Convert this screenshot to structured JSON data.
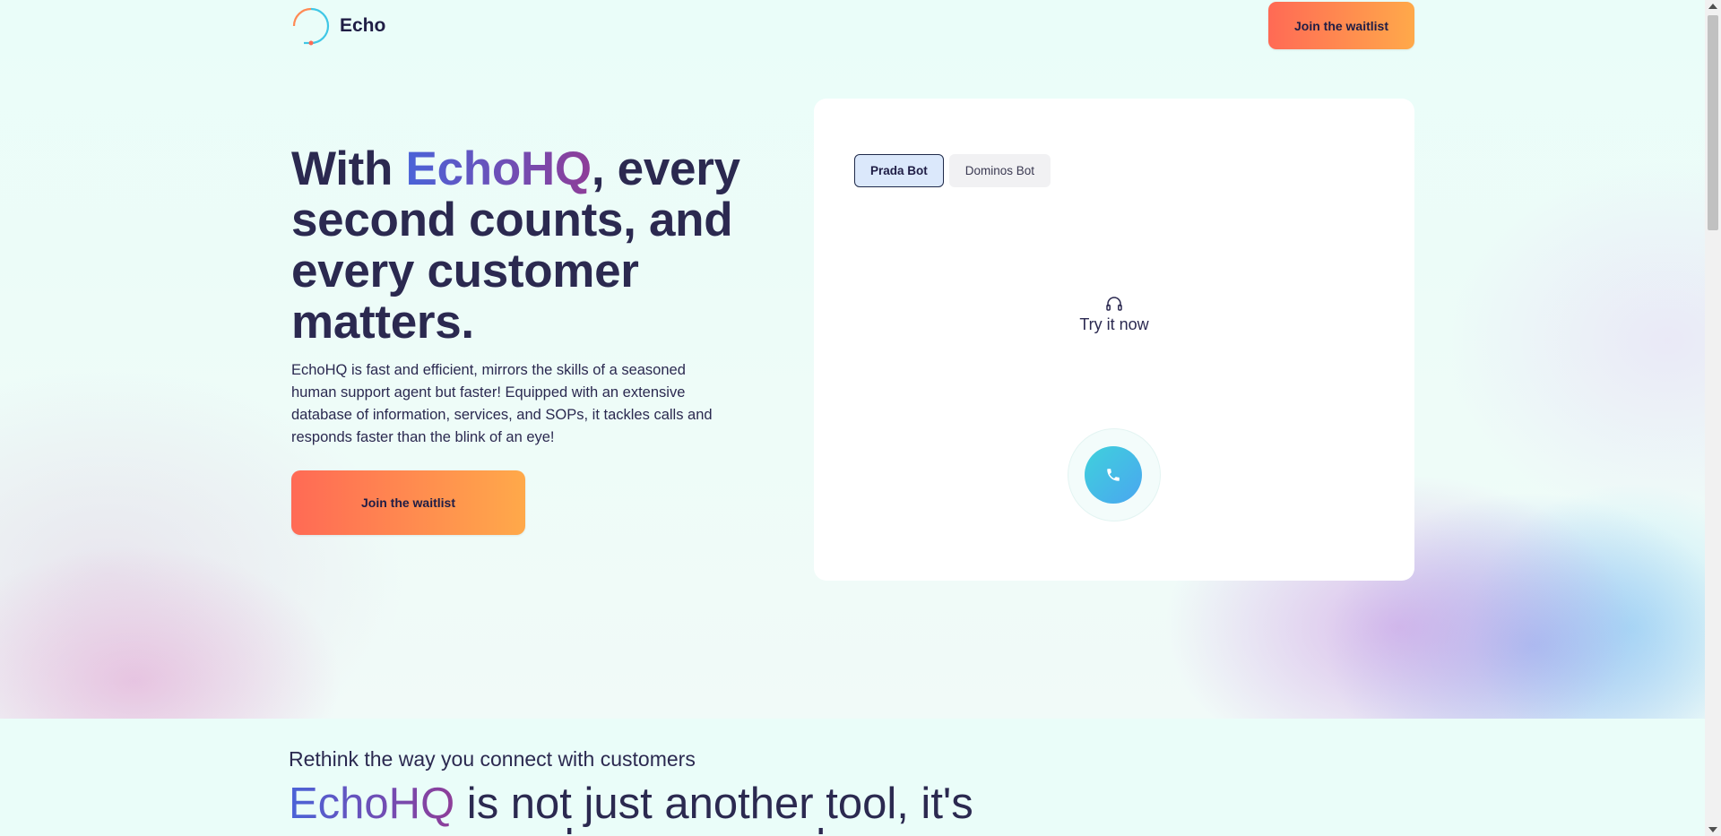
{
  "header": {
    "brand": "Echo",
    "cta_label": "Join the waitlist"
  },
  "hero": {
    "title_prefix": "With ",
    "title_brand": "EchoHQ",
    "title_rest": ", every second counts, and every customer matters.",
    "description": "EchoHQ is fast and efficient, mirrors the skills of a seasoned human support agent but faster! Equipped with an extensive database of information, services, and SOPs, it tackles calls and responds faster than the blink of an eye!",
    "cta_label": "Join the waitlist"
  },
  "demo": {
    "tabs": [
      {
        "label": "Prada Bot",
        "active": true
      },
      {
        "label": "Dominos Bot",
        "active": false
      }
    ],
    "try_label": "Try it now",
    "icons": {
      "headset": "headphones-icon",
      "call": "phone-icon"
    }
  },
  "section": {
    "kicker": "Rethink the way you connect with customers",
    "title_brand": "EchoHQ",
    "title_rest": " is not just another tool, it's",
    "title_next_line": "a customer experience of speed and efficiency"
  },
  "colors": {
    "cta_gradient_start": "#ff6a55",
    "cta_gradient_end": "#ffa94a",
    "brand_gradient_start": "#4a63d8",
    "brand_gradient_end": "#8e3d98",
    "text_dark": "#2b2950",
    "call_button_start": "#3fd1dc",
    "call_button_end": "#4aa6f0"
  }
}
